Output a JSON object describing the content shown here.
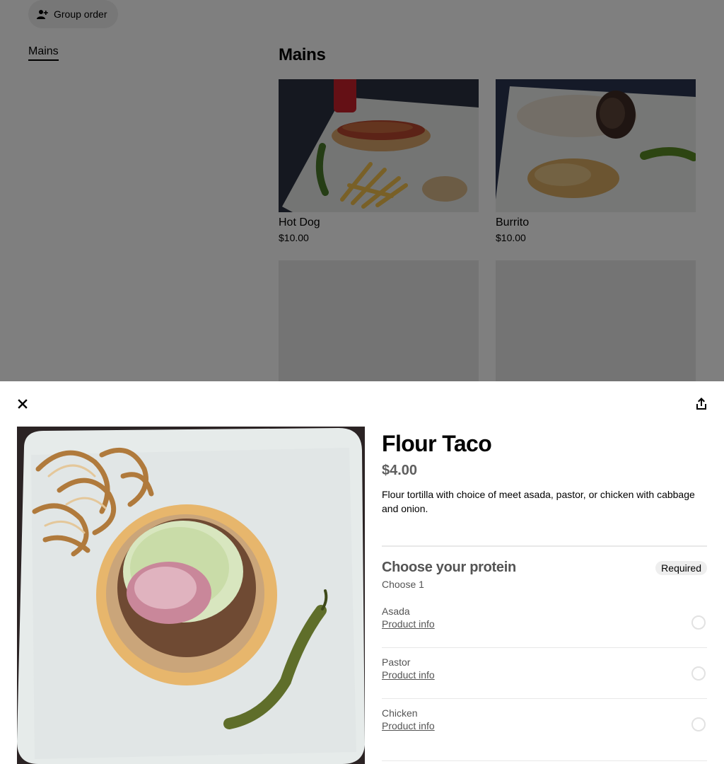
{
  "background": {
    "group_order_label": "Group order",
    "nav_items": [
      "Mains"
    ],
    "section_title": "Mains",
    "cards": [
      {
        "name": "Hot Dog",
        "price": "$10.00"
      },
      {
        "name": "Burrito",
        "price": "$10.00"
      }
    ]
  },
  "modal": {
    "title": "Flour Taco",
    "price": "$4.00",
    "description": "Flour tortilla with choice of meet asada, pastor, or chicken with cabbage and onion.",
    "group": {
      "title": "Choose your protein",
      "badge": "Required",
      "subtitle": "Choose 1",
      "options": [
        {
          "name": "Asada",
          "link": "Product info"
        },
        {
          "name": "Pastor",
          "link": "Product info"
        },
        {
          "name": "Chicken",
          "link": "Product info"
        }
      ]
    }
  },
  "icons": {
    "close": "close-icon",
    "share": "share-icon",
    "group_order": "add-person-icon"
  }
}
